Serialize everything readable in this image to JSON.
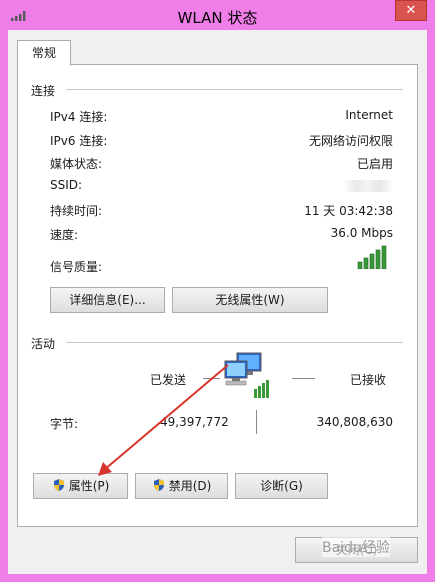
{
  "window": {
    "title": "WLAN 状态",
    "close_glyph": "✕"
  },
  "tabs": [
    {
      "label": "常规"
    }
  ],
  "connection": {
    "header": "连接",
    "rows": [
      {
        "key": "IPv4 连接:",
        "value": "Internet"
      },
      {
        "key": "IPv6 连接:",
        "value": "无网络访问权限"
      },
      {
        "key": "媒体状态:",
        "value": "已启用"
      },
      {
        "key": "SSID:",
        "value": ""
      },
      {
        "key": "持续时间:",
        "value": "11 天 03:42:38"
      },
      {
        "key": "速度:",
        "value": "36.0 Mbps"
      },
      {
        "key": "信号质量:",
        "value": ""
      }
    ],
    "signal_bars": 5,
    "details_button": "详细信息(E)...",
    "wireless_props_button": "无线属性(W)"
  },
  "activity": {
    "header": "活动",
    "sent_label": "已发送",
    "received_label": "已接收",
    "bytes_label": "字节:",
    "bytes_sent": "49,397,772",
    "bytes_received": "340,808,630"
  },
  "buttons": {
    "properties": "属性(P)",
    "disable": "禁用(D)",
    "diagnose": "诊断(G)",
    "close": "关闭(C)"
  },
  "watermark": "Baidu经验",
  "colors": {
    "frame": "#f07ee8",
    "annotation_arrow": "#d9342b",
    "signal": "#3a9a3a"
  },
  "icons": [
    "wifi-signal-icon",
    "network-computers-icon",
    "shield-icon"
  ]
}
